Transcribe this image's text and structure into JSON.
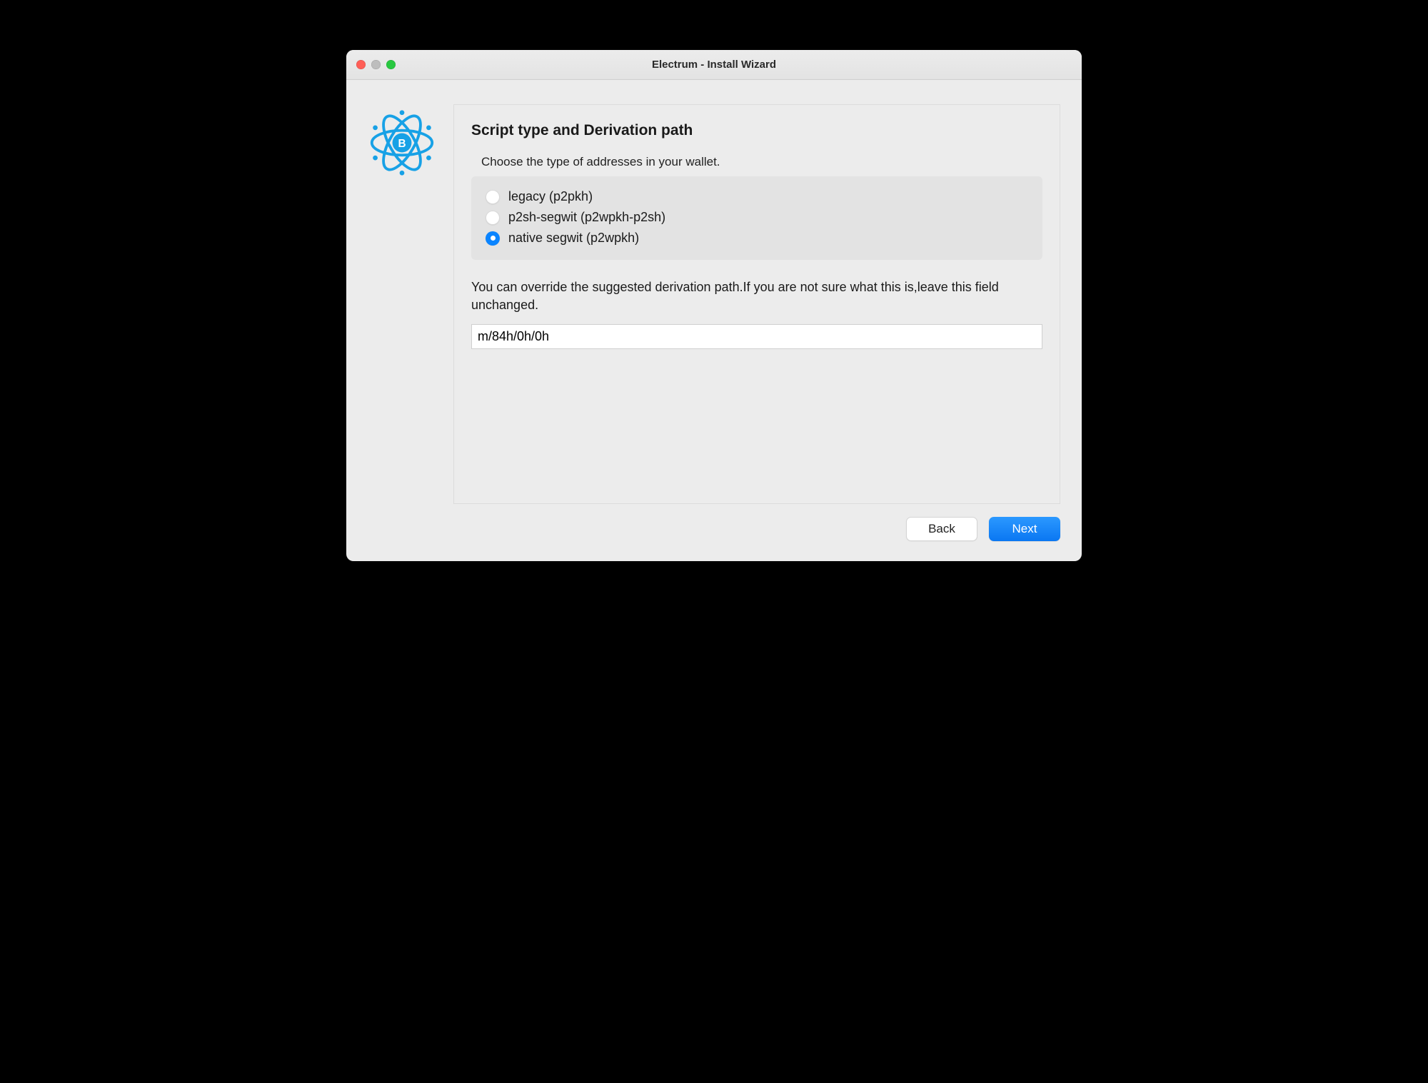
{
  "window_title": "Electrum  -  Install Wizard",
  "section_title": "Script type and Derivation path",
  "choose_prompt": "Choose the type of addresses in your wallet.",
  "options": [
    {
      "label": "legacy (p2pkh)",
      "selected": false
    },
    {
      "label": "p2sh-segwit (p2wpkh-p2sh)",
      "selected": false
    },
    {
      "label": "native segwit (p2wpkh)",
      "selected": true
    }
  ],
  "override_text": "You can override the suggested derivation path.If you are not sure what this is,leave this field unchanged.",
  "derivation_path": "m/84h/0h/0h",
  "buttons": {
    "back": "Back",
    "next": "Next"
  },
  "colors": {
    "accent": "#0a84ff"
  }
}
